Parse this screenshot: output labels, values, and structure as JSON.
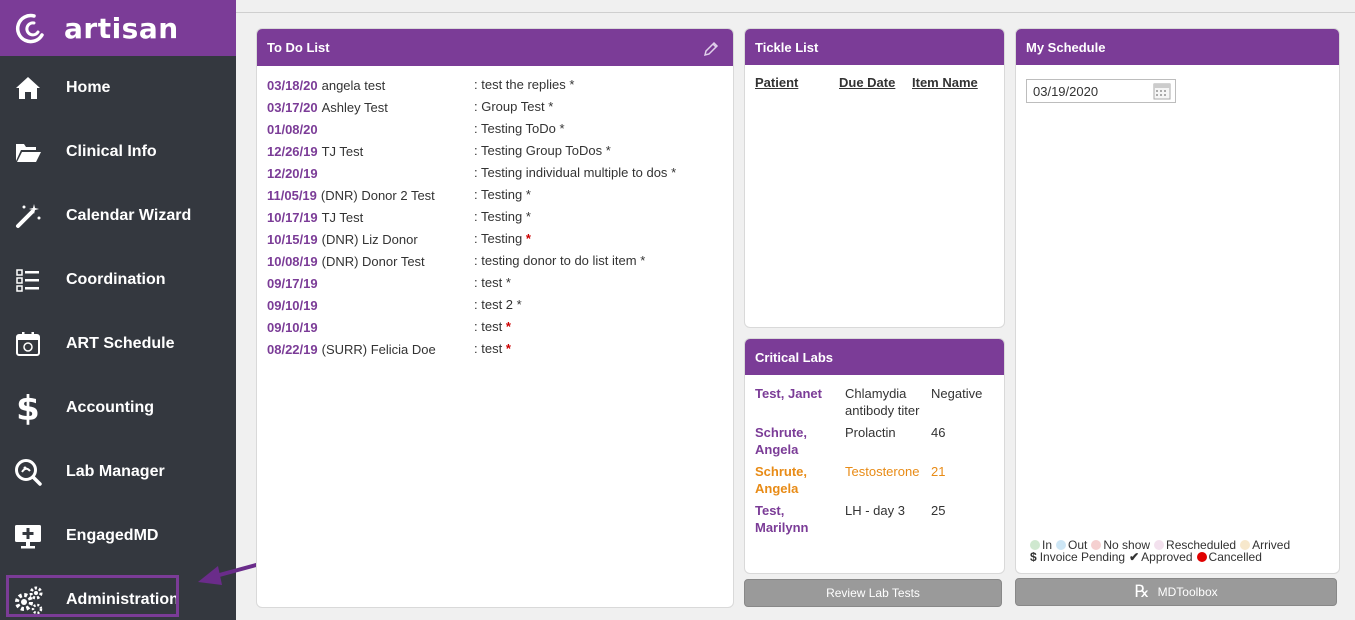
{
  "brand": {
    "name": "artisan"
  },
  "sidebar": {
    "items": [
      {
        "label": "Home",
        "icon": "home-icon"
      },
      {
        "label": "Clinical Info",
        "icon": "folder-open-icon"
      },
      {
        "label": "Calendar Wizard",
        "icon": "magic-wand-icon"
      },
      {
        "label": "Coordination",
        "icon": "checklist-icon"
      },
      {
        "label": "ART Schedule",
        "icon": "calendar-icon"
      },
      {
        "label": "Accounting",
        "icon": "dollar-icon"
      },
      {
        "label": "Lab Manager",
        "icon": "lab-search-icon"
      },
      {
        "label": "EngagedMD",
        "icon": "monitor-plus-icon"
      },
      {
        "label": "Administration",
        "icon": "gears-icon"
      }
    ]
  },
  "todo": {
    "title": "To Do List",
    "rows": [
      {
        "date": "03/18/20",
        "name": "angela test",
        "item": ": test the replies",
        "star": "*",
        "star_red": false
      },
      {
        "date": "03/17/20",
        "name": "Ashley Test",
        "item": ": Group Test",
        "star": "*",
        "star_red": false
      },
      {
        "date": "01/08/20",
        "name": "",
        "item": ": Testing ToDo",
        "star": "*",
        "star_red": false
      },
      {
        "date": "12/26/19",
        "name": "TJ Test",
        "item": ": Testing Group ToDos",
        "star": "*",
        "star_red": false
      },
      {
        "date": "12/20/19",
        "name": "",
        "item": ": Testing individual multiple to dos",
        "star": "*",
        "star_red": false
      },
      {
        "date": "11/05/19",
        "name": "(DNR) Donor 2 Test",
        "item": ": Testing",
        "star": "*",
        "star_red": false
      },
      {
        "date": "10/17/19",
        "name": "TJ Test",
        "item": ": Testing",
        "star": "*",
        "star_red": false
      },
      {
        "date": "10/15/19",
        "name": "(DNR) Liz Donor",
        "item": ": Testing",
        "star": "*",
        "star_red": true
      },
      {
        "date": "10/08/19",
        "name": "(DNR) Donor Test",
        "item": ": testing donor to do list item",
        "star": "*",
        "star_red": false
      },
      {
        "date": "09/17/19",
        "name": "",
        "item": ": test",
        "star": "*",
        "star_red": false
      },
      {
        "date": "09/10/19",
        "name": "",
        "item": ": test 2",
        "star": "*",
        "star_red": false
      },
      {
        "date": "09/10/19",
        "name": "",
        "item": ": test",
        "star": "*",
        "star_red": true
      },
      {
        "date": "08/22/19",
        "name": "(SURR) Felicia Doe",
        "item": ": test",
        "star": "*",
        "star_red": true
      }
    ]
  },
  "tickle": {
    "title": "Tickle List",
    "columns": [
      "Patient",
      "Due Date",
      "Item Name"
    ]
  },
  "labs": {
    "title": "Critical Labs",
    "rows": [
      {
        "patient": "Test, Janet",
        "test": "Chlamydia antibody titer",
        "value": "Negative",
        "alert": false
      },
      {
        "patient": "Schrute, Angela",
        "test": "Prolactin",
        "value": "46",
        "alert": false
      },
      {
        "patient": "Schrute, Angela",
        "test": "Testosterone",
        "value": "21",
        "alert": true
      },
      {
        "patient": "Test, Marilynn",
        "test": "LH - day 3",
        "value": "25",
        "alert": false
      }
    ],
    "review_button": "Review Lab Tests"
  },
  "schedule": {
    "title": "My Schedule",
    "date": "03/19/2020",
    "legend_row1": [
      {
        "label": "In",
        "color": "#cfe8cf"
      },
      {
        "label": "Out",
        "color": "#cde6f5"
      },
      {
        "label": "No show",
        "color": "#f5d0d0"
      },
      {
        "label": "Rescheduled",
        "color": "#f3e1ee"
      },
      {
        "label": "Arrived",
        "color": "#f7e8cc"
      }
    ],
    "legend_row2": {
      "invoice": "Invoice Pending",
      "approved": "Approved",
      "cancelled": "Cancelled",
      "cancelled_color": "#e00000"
    },
    "mdtoolbox_button": "MDToolbox"
  },
  "colors": {
    "accent": "#7b3c97",
    "sidebar": "#34383f",
    "alert": "#e88b16"
  }
}
